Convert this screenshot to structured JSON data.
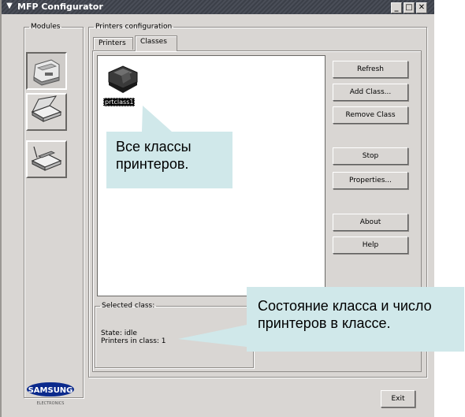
{
  "window": {
    "title": "MFP Configurator"
  },
  "modules": {
    "legend": "Modules"
  },
  "printers_config": {
    "legend": "Printers configuration",
    "tabs": [
      {
        "label": "Printers"
      },
      {
        "label": "Classes"
      }
    ],
    "active_tab": "Classes",
    "classes": [
      {
        "name": "prtclass1"
      }
    ],
    "buttons": {
      "refresh": "Refresh",
      "add_class": "Add Class...",
      "remove_class": "Remove Class",
      "stop": "Stop",
      "properties": "Properties...",
      "about": "About",
      "help": "Help"
    },
    "selected_class": {
      "legend": "Selected class:",
      "state": "State: idle",
      "printers_in_class": "Printers in class: 1"
    }
  },
  "exit_label": "Exit",
  "brand": {
    "name": "SAMSUNG",
    "sub": "ELECTRONICS"
  },
  "callouts": [
    {
      "text": "Все классы\nпринтеров."
    },
    {
      "text": "Состояние класса и число\nпринтеров в классе."
    }
  ],
  "colors": {
    "titlebar": "#3c4049",
    "window_bg": "#d9d6d3",
    "callout": "#d0e8ea",
    "brand": "#0b2a8c"
  }
}
